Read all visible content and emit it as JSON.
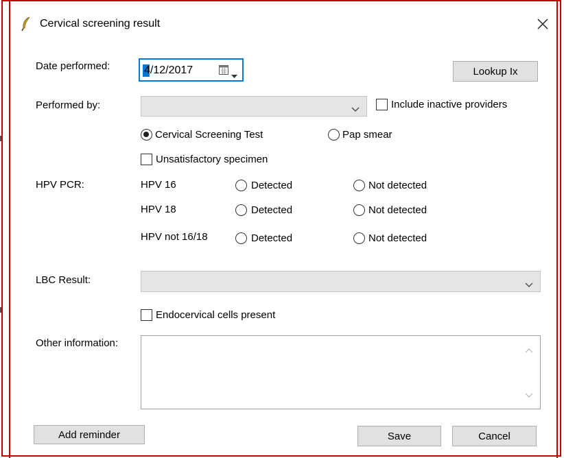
{
  "window": {
    "title": "Cervical screening result"
  },
  "fields": {
    "date_label": "Date performed:",
    "date_value": "4/12/2017",
    "performed_by_label": "Performed by:",
    "performed_by_value": "",
    "include_inactive_label": "Include inactive providers",
    "hpv_label": "HPV PCR:",
    "lbc_label": "LBC Result:",
    "lbc_value": "",
    "other_label": "Other information:",
    "other_value": ""
  },
  "test_type": {
    "options": [
      "Cervical Screening Test",
      "Pap smear"
    ],
    "selected": "Cervical Screening Test"
  },
  "unsatisfactory_label": "Unsatisfactory specimen",
  "hpv_rows": [
    {
      "type": "HPV 16",
      "detected": "Detected",
      "not_detected": "Not detected"
    },
    {
      "type": "HPV 18",
      "detected": "Detected",
      "not_detected": "Not detected"
    },
    {
      "type": "HPV not 16/18",
      "detected": "Detected",
      "not_detected": "Not detected"
    }
  ],
  "endocervical_label": "Endocervical cells present",
  "buttons": {
    "lookup": "Lookup Ix",
    "add_reminder": "Add reminder",
    "save": "Save",
    "cancel": "Cancel"
  },
  "colors": {
    "frame": "#c00000",
    "focus": "#0078d7",
    "button_bg": "#e1e1e1",
    "combo_bg": "#e5e5e5"
  }
}
